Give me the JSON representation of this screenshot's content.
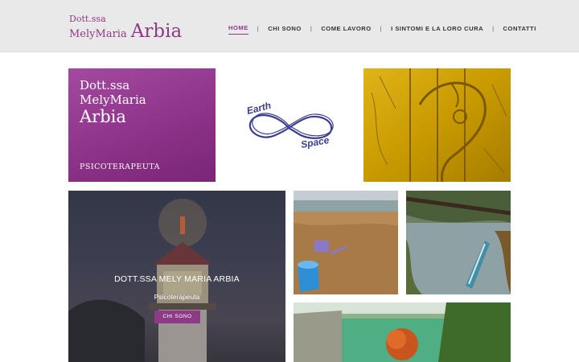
{
  "logo": {
    "line1": "Dott.ssa",
    "line2": "MelyMaria",
    "line3": "Arbia"
  },
  "nav": {
    "items": [
      {
        "label": "HOME",
        "active": true
      },
      {
        "label": "CHI SONO",
        "active": false
      },
      {
        "label": "COME LAVORO",
        "active": false
      },
      {
        "label": "I SINTOMI E LA LORO CURA",
        "active": false
      },
      {
        "label": "CONTATTI",
        "active": false
      }
    ],
    "separator": "|"
  },
  "intro_tile": {
    "line1": "Dott.ssa",
    "line2": "MelyMaria",
    "line3": "Arbia",
    "role": "PSICOTERAPEUTA"
  },
  "earth_space": {
    "word1": "Earth",
    "word2": "Space"
  },
  "feature": {
    "title": "DOTT.SSA MELY MARIA ARBIA",
    "subtitle": "Psicoterapeuta",
    "button": "CHI SONO"
  },
  "colors": {
    "brand": "#8e3a86",
    "header_bg": "#e9e9e9",
    "text": "#333333"
  }
}
